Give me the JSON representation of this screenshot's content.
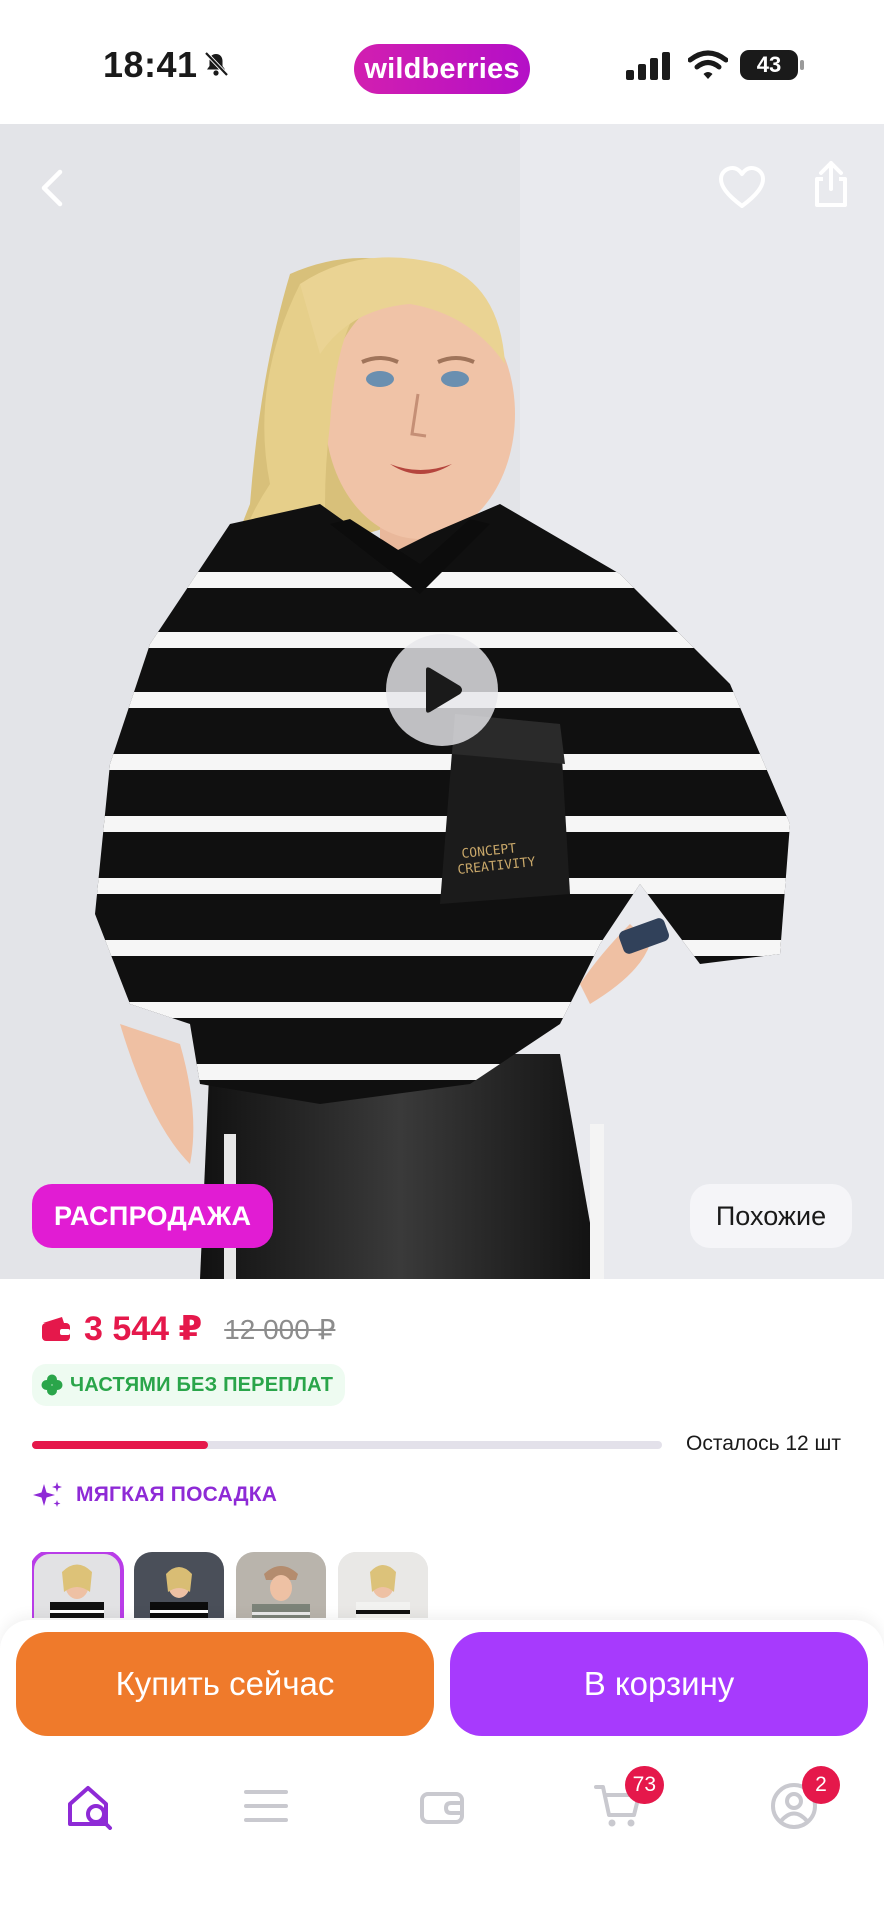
{
  "status_bar": {
    "time": "18:41",
    "brand": "wildberries",
    "battery": "43",
    "icons": [
      "bell-off-icon",
      "cellular-signal-icon",
      "wifi-icon",
      "battery-icon"
    ]
  },
  "hero": {
    "icons": [
      "back-arrow-icon",
      "heart-icon",
      "share-icon",
      "play-icon"
    ],
    "sale_badge": "РАСПРОДАЖА",
    "similar_button": "Похожие",
    "print_text_line1": "CONCEPT",
    "print_text_line2": "CREATIVITY"
  },
  "product": {
    "price": "3 544 ₽",
    "old_price": "12 000 ₽",
    "installment_label": "ЧАСТЯМИ БЕЗ ПЕРЕПЛАТ",
    "stock_label": "Осталось 12 шт",
    "stock_fraction": 0.28,
    "fit_label": "МЯГКАЯ ПОСАДКА"
  },
  "thumbnails": {
    "count": 4,
    "active_index": 0
  },
  "actions": {
    "buy_now": "Купить сейчас",
    "add_to_cart": "В корзину"
  },
  "tabbar": {
    "items": [
      {
        "icon": "home-search-icon",
        "active": true
      },
      {
        "icon": "catalog-menu-icon",
        "active": false
      },
      {
        "icon": "wallet-icon",
        "active": false
      },
      {
        "icon": "cart-icon",
        "badge": "73"
      },
      {
        "icon": "profile-icon",
        "badge": "2"
      }
    ]
  },
  "colors": {
    "brand": "#cb11ab",
    "price": "#e5184b",
    "buy_button": "#ef7a2b",
    "cart_button": "#a73afd",
    "installment": "#2aa54a",
    "fit_tag": "#8e2ad6"
  }
}
